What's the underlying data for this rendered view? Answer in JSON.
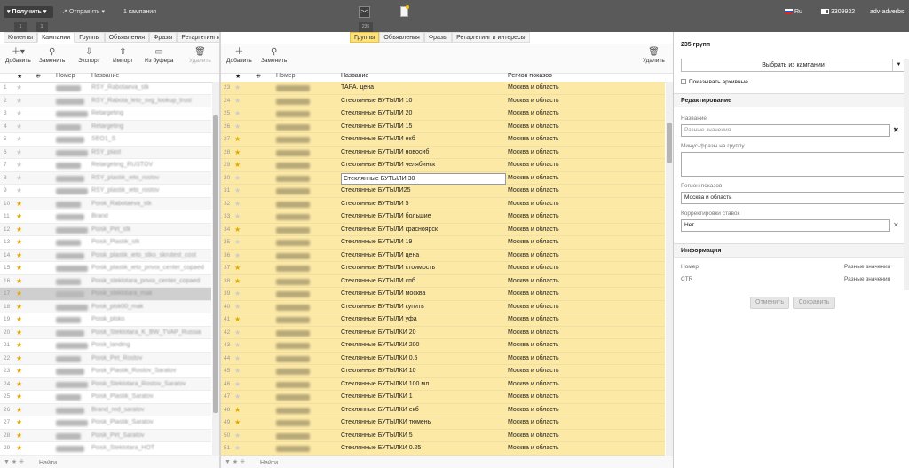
{
  "topbar": {
    "get_label": "Получить",
    "send_label": "Отправить",
    "campaigns_label": "1 кампания",
    "mini_left_1": "1",
    "mini_left_2": "1",
    "mini_mid": "235",
    "lang": "Ru",
    "account_id": "3309932",
    "user": "adv-adverbs"
  },
  "left": {
    "tabs": [
      "Клиенты",
      "Кампании",
      "Группы",
      "Объявления",
      "Фразы",
      "Ретаргетинг и интересы"
    ],
    "tools": [
      "Добавить",
      "Заменить",
      "Экспорт",
      "Импорт",
      "Из буфера",
      "Удалить"
    ],
    "headers": [
      "Номер",
      "Название"
    ],
    "search_placeholder": "Найти",
    "rows": [
      {
        "n": "1",
        "star": false,
        "name": "RSY_Rabotaeva_stk"
      },
      {
        "n": "2",
        "star": false,
        "name": "RSY_Rabota_leto_svg_lookup_trust"
      },
      {
        "n": "3",
        "star": false,
        "name": "Retargeting"
      },
      {
        "n": "4",
        "star": false,
        "name": "Retargeting"
      },
      {
        "n": "5",
        "star": false,
        "name": "SEO1_S"
      },
      {
        "n": "6",
        "star": false,
        "name": "RSY_plast"
      },
      {
        "n": "7",
        "star": false,
        "name": "Retargeting_RUSTOV"
      },
      {
        "n": "8",
        "star": false,
        "name": "RSY_plastik_ieto_rostov"
      },
      {
        "n": "9",
        "star": false,
        "name": "RSY_plastik_ieto_rostov"
      },
      {
        "n": "10",
        "star": true,
        "name": "Poisk_Rabotaeva_stk"
      },
      {
        "n": "11",
        "star": true,
        "name": "Brand"
      },
      {
        "n": "12",
        "star": true,
        "name": "Poisk_Pet_stk"
      },
      {
        "n": "13",
        "star": true,
        "name": "Poisk_Plastik_stk"
      },
      {
        "n": "14",
        "star": true,
        "name": "Poisk_plastik_ieto_stko_skrutest_cost"
      },
      {
        "n": "15",
        "star": true,
        "name": "Poisk_plastik_ieto_privoi_center_copaed"
      },
      {
        "n": "16",
        "star": true,
        "name": "Poisk_steklotara_privoi_center_copaed"
      },
      {
        "n": "17",
        "star": true,
        "name": "Poisk_steklotara_mak"
      },
      {
        "n": "18",
        "star": true,
        "name": "Poisk_plsk00_mak"
      },
      {
        "n": "19",
        "star": true,
        "name": "Poisk_plsko"
      },
      {
        "n": "20",
        "star": true,
        "name": "Poisk_Steklotara_K_BW_TVAP_Russia"
      },
      {
        "n": "21",
        "star": true,
        "name": "Poisk_landing"
      },
      {
        "n": "22",
        "star": true,
        "name": "Poisk_Pet_Rostov"
      },
      {
        "n": "23",
        "star": true,
        "name": "Poisk_Plastik_Rostov_Saratov"
      },
      {
        "n": "24",
        "star": true,
        "name": "Poisk_Steklotara_Rostov_Saratov"
      },
      {
        "n": "25",
        "star": true,
        "name": "Poisk_Plastik_Saratov"
      },
      {
        "n": "26",
        "star": true,
        "name": "Brand_red_saratov"
      },
      {
        "n": "27",
        "star": true,
        "name": "Poisk_Plastik_Saratov"
      },
      {
        "n": "28",
        "star": true,
        "name": "Poisk_Pet_Saratov"
      },
      {
        "n": "29",
        "star": true,
        "name": "Poisk_Steklotara_HOT"
      }
    ]
  },
  "mid": {
    "tabs": [
      "Группы",
      "Объявления",
      "Фразы",
      "Ретаргетинг и интересы"
    ],
    "tools": [
      "Добавить",
      "Заменить",
      "Удалить"
    ],
    "headers": [
      "Номер",
      "Название",
      "Регион показов"
    ],
    "search_placeholder": "Найти",
    "region": "Москва и область",
    "rows": [
      {
        "n": "23",
        "star": false,
        "name": "ТАРА. цена"
      },
      {
        "n": "24",
        "star": false,
        "name": "Стеклянные БУТЫЛИ 10"
      },
      {
        "n": "25",
        "star": false,
        "name": "Стеклянные БУТЫЛИ 20"
      },
      {
        "n": "26",
        "star": false,
        "name": "Стеклянные БУТЫЛИ 15"
      },
      {
        "n": "27",
        "star": true,
        "name": "Стеклянные БУТЫЛИ екб"
      },
      {
        "n": "28",
        "star": true,
        "name": "Стеклянные БУТЫЛИ новосиб"
      },
      {
        "n": "29",
        "star": true,
        "name": "Стеклянные БУТЫЛИ челябинск"
      },
      {
        "n": "30",
        "star": false,
        "name": "Стеклянные БУТЫЛИ 30"
      },
      {
        "n": "31",
        "star": false,
        "name": "Стеклянные БУТЫЛИ25"
      },
      {
        "n": "32",
        "star": false,
        "name": "Стеклянные БУТЫЛИ 5"
      },
      {
        "n": "33",
        "star": false,
        "name": "Стеклянные БУТЫЛИ большие"
      },
      {
        "n": "34",
        "star": true,
        "name": "Стеклянные БУТЫЛИ красноярск"
      },
      {
        "n": "35",
        "star": false,
        "name": "Стеклянные БУТЫЛИ 19"
      },
      {
        "n": "36",
        "star": false,
        "name": "Стеклянные БУТЫЛИ цена"
      },
      {
        "n": "37",
        "star": true,
        "name": "Стеклянные БУТЫЛИ стоимость"
      },
      {
        "n": "38",
        "star": true,
        "name": "Стеклянные БУТЫЛИ спб"
      },
      {
        "n": "39",
        "star": false,
        "name": "Стеклянные БУТЫЛИ москва"
      },
      {
        "n": "40",
        "star": false,
        "name": "Стеклянные БУТЫЛИ купить"
      },
      {
        "n": "41",
        "star": true,
        "name": "Стеклянные БУТЫЛИ уфа"
      },
      {
        "n": "42",
        "star": false,
        "name": "Стеклянные БУТЫЛКИ 20"
      },
      {
        "n": "43",
        "star": false,
        "name": "Стеклянные БУТЫЛКИ 200"
      },
      {
        "n": "44",
        "star": false,
        "name": "Стеклянные БУТЫЛКИ 0.5"
      },
      {
        "n": "45",
        "star": false,
        "name": "Стеклянные БУТЫЛКИ 10"
      },
      {
        "n": "46",
        "star": false,
        "name": "Стеклянные БУТЫЛКИ 100 мл"
      },
      {
        "n": "47",
        "star": false,
        "name": "Стеклянные БУТЫЛКИ 1"
      },
      {
        "n": "48",
        "star": true,
        "name": "Стеклянные БУТЫЛКИ екб"
      },
      {
        "n": "49",
        "star": true,
        "name": "Стеклянные БУТЫЛКИ тюмень"
      },
      {
        "n": "50",
        "star": false,
        "name": "Стеклянные БУТЫЛКИ 5"
      },
      {
        "n": "51",
        "star": false,
        "name": "Стеклянные БУТЫЛКИ 0.25"
      }
    ]
  },
  "right": {
    "count": "235 групп",
    "select_label": "Выбрать из кампании",
    "archive_label": "Показывать архивные",
    "edit_section": "Редактирование",
    "name_label": "Название",
    "name_placeholder": "Разные значения",
    "minus_label": "Минус-фразы на группу",
    "region_label": "Регион показов",
    "region_value": "Москва и область",
    "bid_label": "Корректировки ставок",
    "bid_value": "Нет",
    "info_section": "Информация",
    "info_rows": [
      {
        "label": "Номер",
        "value": "Разные значения"
      },
      {
        "label": "CTR",
        "value": "Разные значения"
      }
    ],
    "cancel_label": "Отменить",
    "save_label": "Сохранить"
  }
}
